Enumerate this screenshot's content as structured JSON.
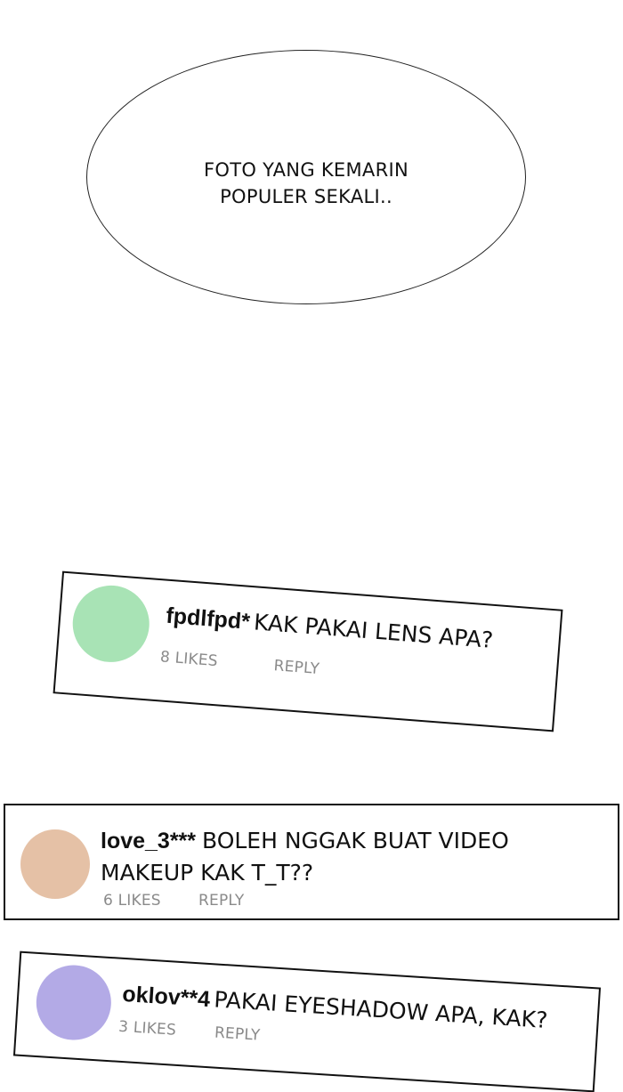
{
  "speech_bubble": {
    "line1": "FOTO YANG KEMARIN",
    "line2": "POPULER SEKALI.."
  },
  "comments": [
    {
      "username": "fpdlfpd*",
      "text": "KAK PAKAI LENS APA?",
      "likes": "8 LIKES",
      "reply": "REPLY",
      "avatar_color": "#a8e3b5"
    },
    {
      "username": "love_3***",
      "text_line1": "BOLEH NGGAK BUAT VIDEO",
      "text_line2": "MAKEUP KAK T_T??",
      "likes": "6 LIKES",
      "reply": "REPLY",
      "avatar_color": "#e5c1a6"
    },
    {
      "username": "oklov**4",
      "text": "PAKAI EYESHADOW APA, KAK?",
      "likes": "3 LIKES",
      "reply": "REPLY",
      "avatar_color": "#b3aae6"
    }
  ]
}
